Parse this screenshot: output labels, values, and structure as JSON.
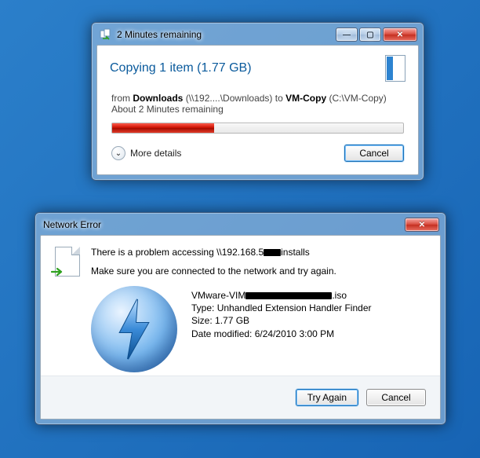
{
  "copy_dialog": {
    "title": "2 Minutes remaining",
    "heading": "Copying 1 item (1.77 GB)",
    "from_label": "from",
    "from_name": "Downloads",
    "from_path": "(\\\\192....\\Downloads)",
    "to_label": "to",
    "to_name": "VM-Copy",
    "to_path": "(C:\\VM-Copy)",
    "remaining": "About 2 Minutes remaining",
    "progress_percent": 35,
    "more_details": "More details",
    "cancel": "Cancel"
  },
  "error_dialog": {
    "title": "Network Error",
    "message1_pre": "There is a problem accessing \\\\192.168.5",
    "message1_post": "installs",
    "message2": "Make sure you are connected to the network and try again.",
    "file": {
      "name_pre": "VMware-VIM",
      "name_post": ".iso",
      "type_label": "Type:",
      "type_value": "Unhandled Extension Handler Finder",
      "size_label": "Size:",
      "size_value": "1.77 GB",
      "date_label": "Date modified:",
      "date_value": "6/24/2010 3:00 PM"
    },
    "try_again": "Try Again",
    "cancel": "Cancel"
  },
  "win_buttons": {
    "minimize": "—",
    "maximize": "▢",
    "close": "✕"
  }
}
